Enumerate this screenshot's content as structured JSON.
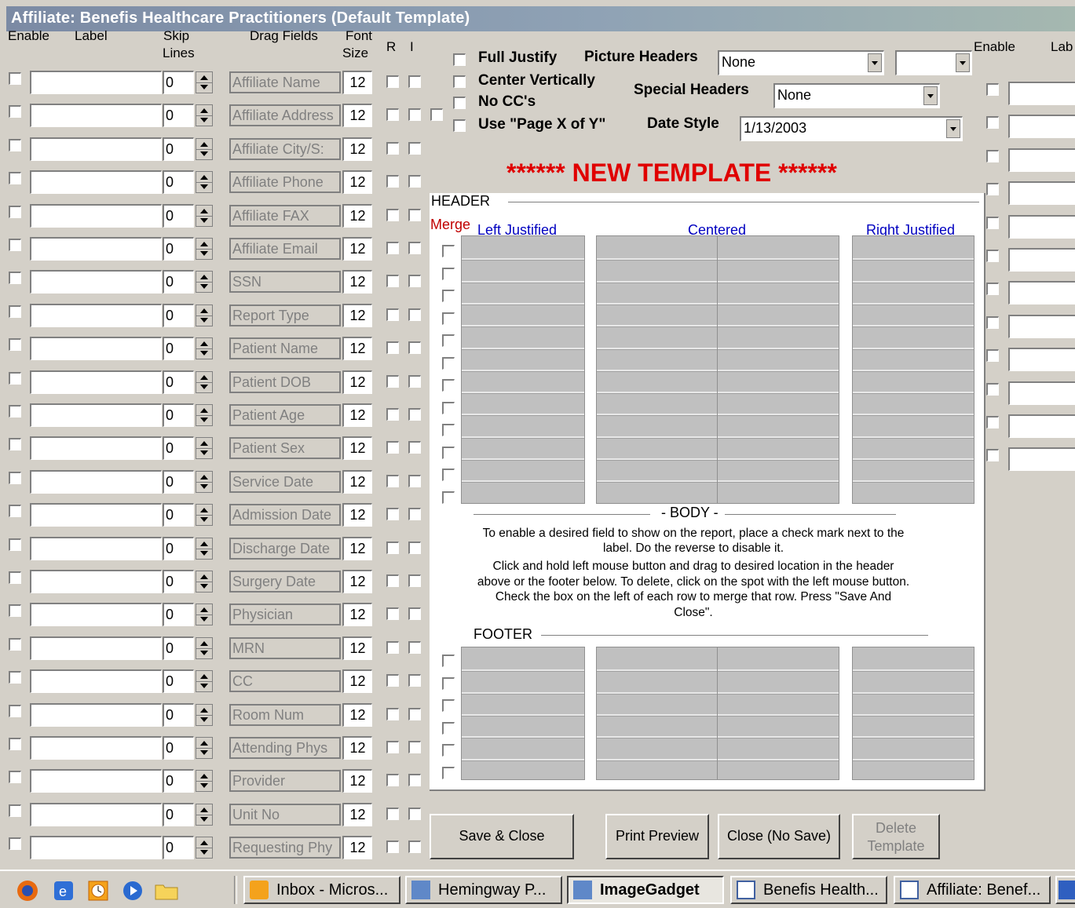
{
  "window": {
    "title": "Affiliate: Benefis Healthcare Practitioners  (Default Template)"
  },
  "left_headers": {
    "enable": "Enable",
    "label": "Label",
    "skip": "Skip",
    "lines": "Lines",
    "drag_fields": "Drag Fields",
    "font": "Font",
    "size": "Size",
    "r": "R",
    "i": "I"
  },
  "rows": [
    {
      "skip": "0",
      "field": "Affiliate Name",
      "font": "12"
    },
    {
      "skip": "0",
      "field": "Affiliate Address",
      "font": "12"
    },
    {
      "skip": "0",
      "field": "Affiliate City/S:",
      "font": "12"
    },
    {
      "skip": "0",
      "field": "Affiliate Phone",
      "font": "12"
    },
    {
      "skip": "0",
      "field": "Affiliate FAX",
      "font": "12"
    },
    {
      "skip": "0",
      "field": "Affiliate Email",
      "font": "12"
    },
    {
      "skip": "0",
      "field": "SSN",
      "font": "12"
    },
    {
      "skip": "0",
      "field": "Report Type",
      "font": "12"
    },
    {
      "skip": "0",
      "field": "Patient Name",
      "font": "12"
    },
    {
      "skip": "0",
      "field": "Patient DOB",
      "font": "12"
    },
    {
      "skip": "0",
      "field": "Patient Age",
      "font": "12"
    },
    {
      "skip": "0",
      "field": "Patient Sex",
      "font": "12"
    },
    {
      "skip": "0",
      "field": "Service Date",
      "font": "12"
    },
    {
      "skip": "0",
      "field": "Admission Date",
      "font": "12"
    },
    {
      "skip": "0",
      "field": "Discharge Date",
      "font": "12"
    },
    {
      "skip": "0",
      "field": "Surgery Date",
      "font": "12"
    },
    {
      "skip": "0",
      "field": "Physician",
      "font": "12"
    },
    {
      "skip": "0",
      "field": "MRN",
      "font": "12"
    },
    {
      "skip": "0",
      "field": "CC",
      "font": "12"
    },
    {
      "skip": "0",
      "field": "Room Num",
      "font": "12"
    },
    {
      "skip": "0",
      "field": "Attending Phys",
      "font": "12"
    },
    {
      "skip": "0",
      "field": "Provider",
      "font": "12"
    },
    {
      "skip": "0",
      "field": "Unit No",
      "font": "12"
    },
    {
      "skip": "0",
      "field": "Requesting Phy",
      "font": "12"
    }
  ],
  "options": {
    "full_justify": "Full Justify",
    "center_vertically": "Center Vertically",
    "no_ccs": "No CC's",
    "page_x_of_y": "Use \"Page X of Y\"",
    "picture_headers_label": "Picture Headers",
    "picture_headers_value": "None",
    "special_headers_label": "Special Headers",
    "special_headers_value": "None",
    "date_style_label": "Date Style",
    "date_style_value": "1/13/2003"
  },
  "banner": "****** NEW TEMPLATE ******",
  "header_section": {
    "title": "HEADER",
    "merge": "Merge",
    "left": "Left Justified",
    "center": "Centered",
    "right": "Right Justified"
  },
  "body_section": {
    "title": "- BODY -",
    "p1": "To enable a desired field to show on the report, place a check mark next to the label. Do the reverse to disable it.",
    "p2": "Click and hold left mouse button and drag to desired location in the header above or the footer below. To delete, click on the spot with the left mouse button. Check the box on the left of each row to merge that row. Press \"Save And Close\"."
  },
  "footer_section": {
    "title": "FOOTER"
  },
  "buttons": {
    "save_close": "Save & Close",
    "print_preview": "Print Preview",
    "close_no_save": "Close (No Save)",
    "delete_template": "Delete Template"
  },
  "right_headers": {
    "enable": "Enable",
    "label": "Lab"
  },
  "taskbar": {
    "tasks": [
      "Inbox - Micros...",
      "Hemingway P...",
      "ImageGadget",
      "Benefis Health...",
      "Affiliate: Benef..."
    ]
  }
}
